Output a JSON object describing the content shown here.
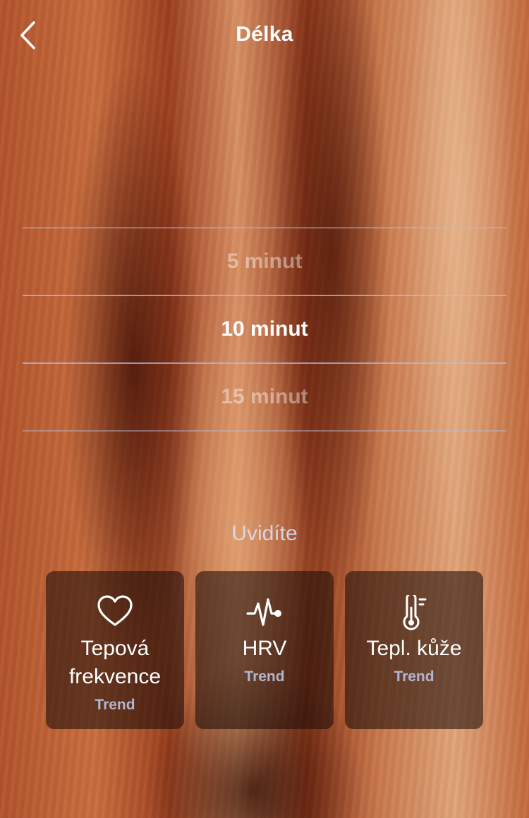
{
  "header": {
    "title": "Délka",
    "back_icon": "chevron-left-icon"
  },
  "duration_picker": {
    "options": [
      "5 minut",
      "10 minut",
      "15 minut"
    ],
    "selected": "10 minut"
  },
  "you_will_see": {
    "heading": "Uvidíte",
    "cards": [
      {
        "icon": "heart-icon",
        "label_line1": "Tepová",
        "label_line2": "frekvence",
        "sub": "Trend"
      },
      {
        "icon": "pulse-icon",
        "label_line1": "HRV",
        "sub": "Trend"
      },
      {
        "icon": "thermometer-icon",
        "label_line1": "Tepl. kůže",
        "sub": "Trend"
      }
    ]
  },
  "colors": {
    "text": "#ffffff",
    "muted": "#b9c3e1",
    "card_bg": "#1e0e08"
  }
}
